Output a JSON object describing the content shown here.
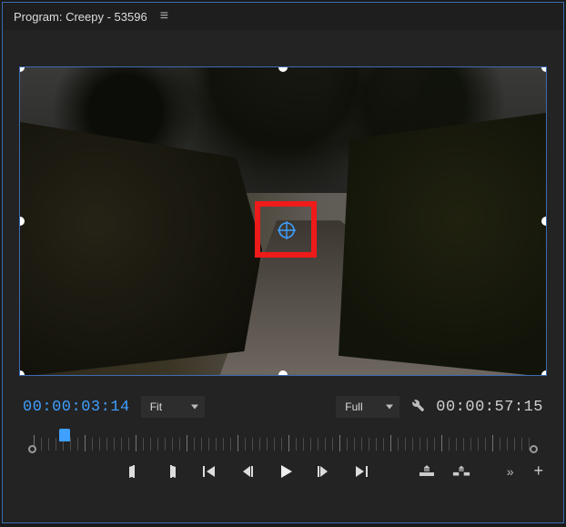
{
  "panel": {
    "title": "Program: Creepy - 53596"
  },
  "player": {
    "current_tc": "00:00:03:14",
    "duration_tc": "00:00:57:15",
    "zoom_label": "Fit",
    "resolution_label": "Full"
  },
  "icons": {
    "hamburger": "≡",
    "wrench": "🔧"
  }
}
